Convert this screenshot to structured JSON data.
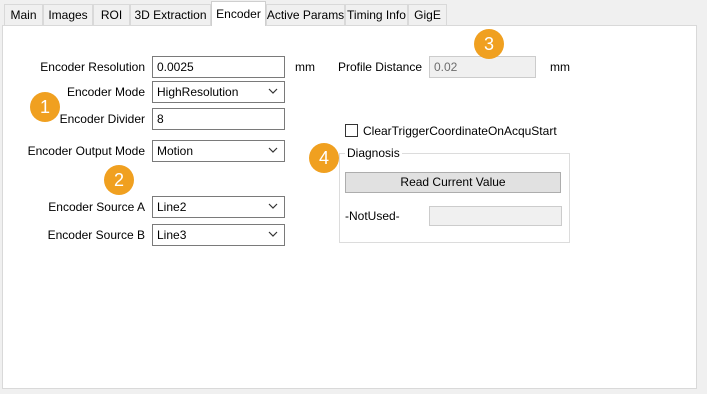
{
  "tabs": [
    {
      "label": "Main"
    },
    {
      "label": "Images"
    },
    {
      "label": "ROI"
    },
    {
      "label": "3D Extraction"
    },
    {
      "label": "Encoder",
      "active": true
    },
    {
      "label": "Active Params"
    },
    {
      "label": "Timing Info"
    },
    {
      "label": "GigE"
    }
  ],
  "encoder": {
    "resolution_label": "Encoder Resolution",
    "resolution_value": "0.0025",
    "resolution_unit": "mm",
    "mode_label": "Encoder Mode",
    "mode_value": "HighResolution",
    "divider_label": "Encoder Divider",
    "divider_value": "8",
    "output_mode_label": "Encoder Output Mode",
    "output_mode_value": "Motion",
    "source_a_label": "Encoder Source A",
    "source_a_value": "Line2",
    "source_b_label": "Encoder Source B",
    "source_b_value": "Line3"
  },
  "profile": {
    "distance_label": "Profile Distance",
    "distance_value": "0.02",
    "distance_unit": "mm"
  },
  "clear_trigger": {
    "label": "ClearTriggerCoordinateOnAcquStart",
    "checked": false
  },
  "diagnosis": {
    "title": "Diagnosis",
    "read_button": "Read Current Value",
    "not_used_label": "-NotUsed-",
    "not_used_value": ""
  },
  "badges": [
    "1",
    "2",
    "3",
    "4"
  ],
  "colors": {
    "badge": "#f0a020",
    "panel_background": "#ffffff",
    "window_background": "#f0f0f0"
  }
}
